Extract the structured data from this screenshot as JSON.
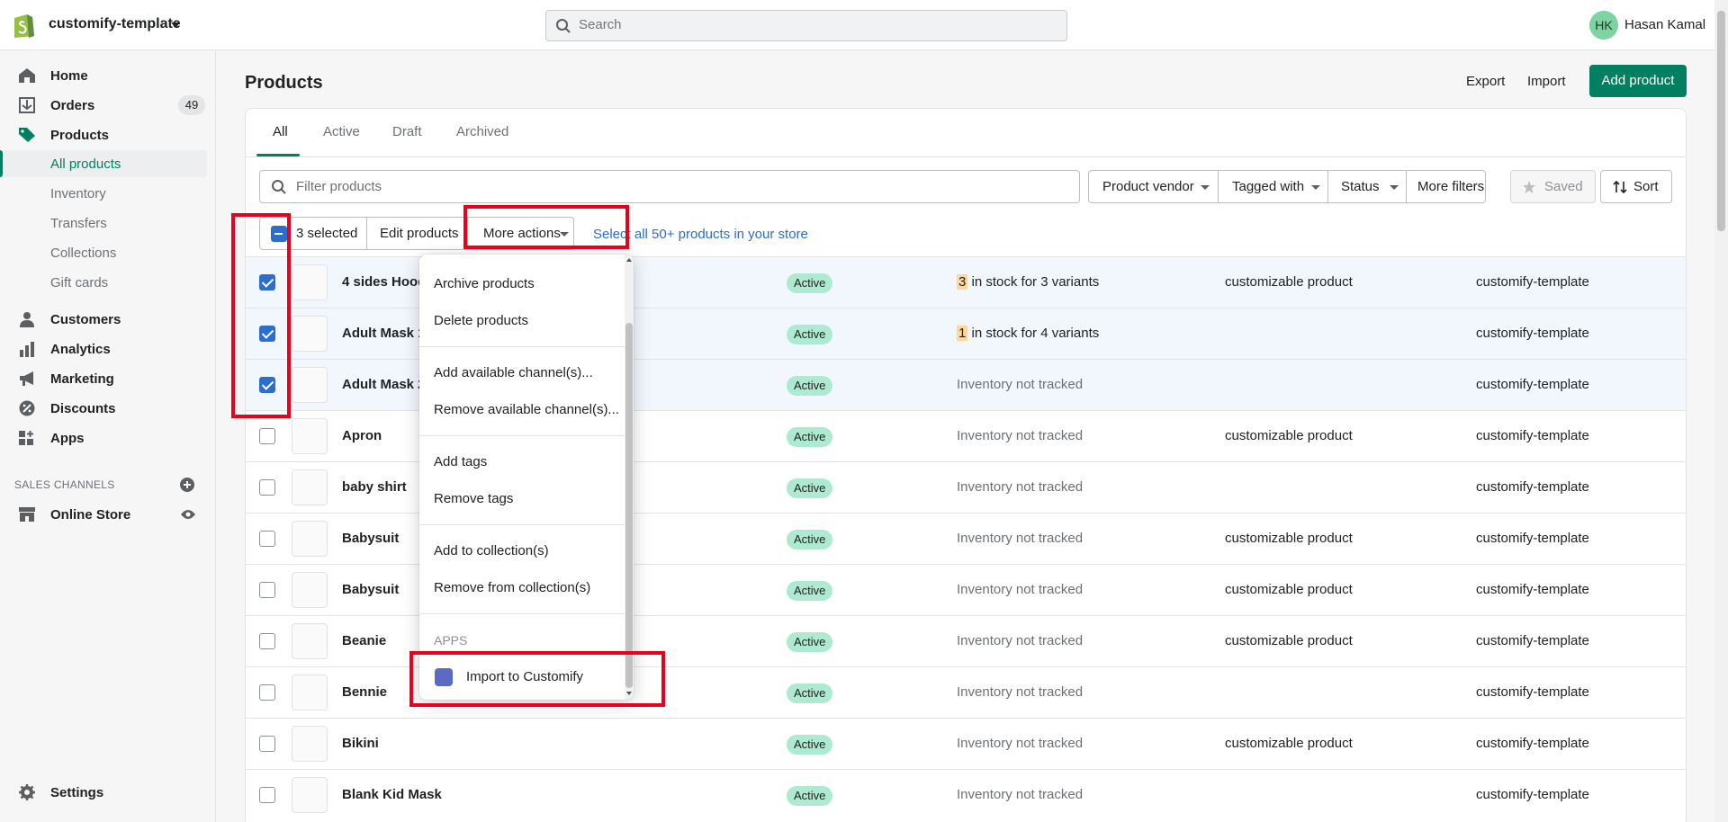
{
  "topbar": {
    "store_name": "customify-template",
    "search_placeholder": "Search",
    "user_initials": "HK",
    "user_name": "Hasan Kamal"
  },
  "sidebar": {
    "items": [
      {
        "label": "Home",
        "icon": "home-icon"
      },
      {
        "label": "Orders",
        "icon": "orders-icon",
        "badge": "49"
      },
      {
        "label": "Products",
        "icon": "tag-icon"
      }
    ],
    "product_sub": [
      "All products",
      "Inventory",
      "Transfers",
      "Collections",
      "Gift cards"
    ],
    "items2": [
      {
        "label": "Customers",
        "icon": "person-icon"
      },
      {
        "label": "Analytics",
        "icon": "bar-chart-icon"
      },
      {
        "label": "Marketing",
        "icon": "megaphone-icon"
      },
      {
        "label": "Discounts",
        "icon": "discount-icon"
      },
      {
        "label": "Apps",
        "icon": "apps-icon"
      }
    ],
    "sales_channels_title": "SALES CHANNELS",
    "online_store": "Online Store",
    "settings": "Settings"
  },
  "page": {
    "title": "Products",
    "export": "Export",
    "import": "Import",
    "add_product": "Add product"
  },
  "tabs": [
    "All",
    "Active",
    "Draft",
    "Archived"
  ],
  "filters": {
    "placeholder": "Filter products",
    "vendor": "Product vendor",
    "tagged": "Tagged with",
    "status": "Status",
    "more": "More filters",
    "saved": "Saved",
    "sort": "Sort"
  },
  "bulk": {
    "selected": "3 selected",
    "edit": "Edit products",
    "more_actions": "More actions",
    "select_all": "Select all 50+ products in your store"
  },
  "dropdown": {
    "group1": [
      "Archive products",
      "Delete products"
    ],
    "group2": [
      "Add available channel(s)...",
      "Remove available channel(s)..."
    ],
    "group3": [
      "Add tags",
      "Remove tags"
    ],
    "group4": [
      "Add to collection(s)",
      "Remove from collection(s)"
    ],
    "apps_title": "APPS",
    "app_action": "Import to Customify"
  },
  "rows": [
    {
      "name": "4 sides Hoodie",
      "status": "Active",
      "inv_count": "3",
      "inv_text": " in stock for 3 variants",
      "type": "customizable product",
      "vendor": "customify-template",
      "selected": true
    },
    {
      "name": "Adult Mask 1",
      "status": "Active",
      "inv_count": "1",
      "inv_text": " in stock for 4 variants",
      "type": "",
      "vendor": "customify-template",
      "selected": true
    },
    {
      "name": "Adult Mask 2",
      "status": "Active",
      "inv_count": "",
      "inv_text": "Inventory not tracked",
      "type": "",
      "vendor": "customify-template",
      "selected": true
    },
    {
      "name": "Apron",
      "status": "Active",
      "inv_count": "",
      "inv_text": "Inventory not tracked",
      "type": "customizable product",
      "vendor": "customify-template",
      "selected": false
    },
    {
      "name": "baby shirt",
      "status": "Active",
      "inv_count": "",
      "inv_text": "Inventory not tracked",
      "type": "",
      "vendor": "customify-template",
      "selected": false
    },
    {
      "name": "Babysuit",
      "status": "Active",
      "inv_count": "",
      "inv_text": "Inventory not tracked",
      "type": "customizable product",
      "vendor": "customify-template",
      "selected": false
    },
    {
      "name": "Babysuit",
      "status": "Active",
      "inv_count": "",
      "inv_text": "Inventory not tracked",
      "type": "customizable product",
      "vendor": "customify-template",
      "selected": false
    },
    {
      "name": "Beanie",
      "status": "Active",
      "inv_count": "",
      "inv_text": "Inventory not tracked",
      "type": "customizable product",
      "vendor": "customify-template",
      "selected": false
    },
    {
      "name": "Bennie",
      "status": "Active",
      "inv_count": "",
      "inv_text": "Inventory not tracked",
      "type": "",
      "vendor": "customify-template",
      "selected": false
    },
    {
      "name": "Bikini",
      "status": "Active",
      "inv_count": "",
      "inv_text": "Inventory not tracked",
      "type": "customizable product",
      "vendor": "customify-template",
      "selected": false
    },
    {
      "name": "Blank Kid Mask",
      "status": "Active",
      "inv_count": "",
      "inv_text": "Inventory not tracked",
      "type": "",
      "vendor": "customify-template",
      "selected": false
    }
  ],
  "colors": {
    "accent": "#008060",
    "link": "#2c6ecb",
    "status_bg": "#aee9d1",
    "annotation": "#e8001c"
  }
}
